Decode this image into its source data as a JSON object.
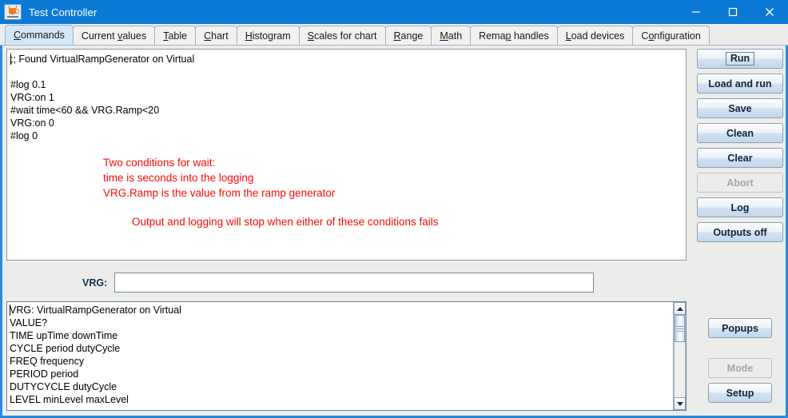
{
  "window": {
    "title": "Test Controller",
    "icon": "java-coffee-cup-icon",
    "accent_color": "#0b7ad5",
    "controls": {
      "minimize": "minimize-icon",
      "maximize": "maximize-icon",
      "close": "close-icon"
    }
  },
  "tabs": {
    "active": "Commands",
    "items": [
      {
        "label": "Commands",
        "mnemonic": "C",
        "active": true
      },
      {
        "label": "Current values",
        "mnemonic": "v",
        "active": false
      },
      {
        "label": "Table",
        "mnemonic": "T",
        "active": false
      },
      {
        "label": "Chart",
        "mnemonic": "C",
        "active": false
      },
      {
        "label": "Histogram",
        "mnemonic": "H",
        "active": false
      },
      {
        "label": "Scales for chart",
        "mnemonic": "S",
        "active": false
      },
      {
        "label": "Range",
        "mnemonic": "R",
        "active": false
      },
      {
        "label": "Math",
        "mnemonic": "M",
        "active": false
      },
      {
        "label": "Remap handles",
        "mnemonic": "p",
        "active": false
      },
      {
        "label": "Load devices",
        "mnemonic": "L",
        "active": false
      },
      {
        "label": "Configuration",
        "mnemonic": "o",
        "active": false
      }
    ]
  },
  "editor": {
    "code_lines": [
      ";; Found VirtualRampGenerator on Virtual",
      "",
      "#log 0.1",
      "VRG:on 1",
      "#wait time<60 && VRG.Ramp<20",
      "VRG:on 0",
      "#log 0"
    ],
    "note_color": "#fb0b07",
    "notes": [
      "Two conditions for wait:",
      "time is seconds into the logging",
      "VRG.Ramp is the value from the ramp generator"
    ],
    "note_indented": "Output and logging will stop when either of these conditions fails"
  },
  "buttons": {
    "primary": [
      {
        "label": "Run",
        "enabled": true,
        "focused": true
      },
      {
        "label": "Load and run",
        "enabled": true,
        "focused": false
      },
      {
        "label": "Save",
        "enabled": true,
        "focused": false
      },
      {
        "label": "Clean",
        "enabled": true,
        "focused": false
      },
      {
        "label": "Clear",
        "enabled": true,
        "focused": false
      },
      {
        "label": "Abort",
        "enabled": false,
        "focused": false
      },
      {
        "label": "Log",
        "enabled": true,
        "focused": false
      },
      {
        "label": "Outputs off",
        "enabled": true,
        "focused": false
      }
    ],
    "secondary": [
      {
        "label": "Popups",
        "enabled": true
      },
      {
        "label": "Mode",
        "enabled": false
      },
      {
        "label": "Setup",
        "enabled": true
      }
    ]
  },
  "command_row": {
    "label": "VRG:",
    "value": "",
    "placeholder": ""
  },
  "output": {
    "lines": [
      "VRG: VirtualRampGenerator on Virtual",
      "VALUE?",
      "TIME upTime downTime",
      "CYCLE period dutyCycle",
      "FREQ frequency",
      "PERIOD period",
      "DUTYCYCLE dutyCycle",
      "LEVEL minLevel maxLevel"
    ],
    "scrollbar": {
      "up_arrow": "scroll-up-icon",
      "down_arrow": "scroll-down-icon"
    }
  }
}
